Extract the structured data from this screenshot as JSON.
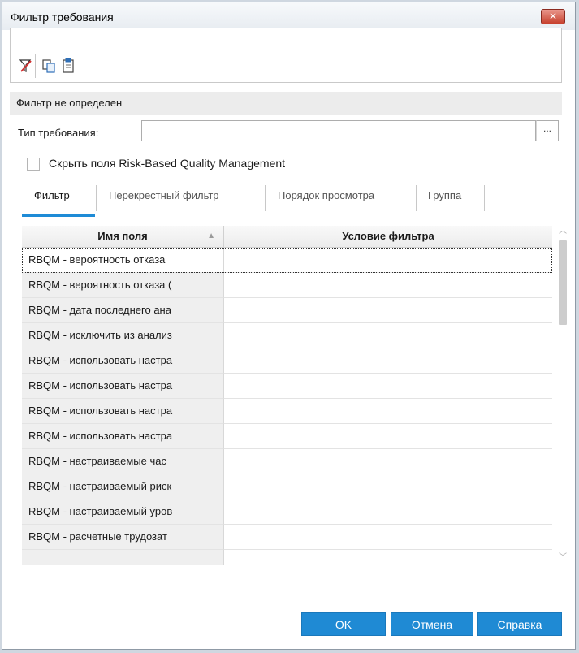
{
  "window": {
    "title": "Фильтр требования",
    "close_glyph": "✕"
  },
  "toolbar": {
    "icons": [
      "filter-clear-icon",
      "copy-icon",
      "paste-icon"
    ]
  },
  "filter_status": "Фильтр не определен",
  "requirement_type": {
    "label": "Тип требования:",
    "value": "",
    "browse_label": "..."
  },
  "hide_rbqm": {
    "label": "Скрыть поля Risk-Based Quality Management",
    "checked": false
  },
  "tabs": [
    {
      "label": "Фильтр",
      "active": true
    },
    {
      "label": "Перекрестный фильтр",
      "active": false
    },
    {
      "label": "Порядок просмотра",
      "active": false
    },
    {
      "label": "Группа",
      "active": false
    }
  ],
  "grid": {
    "columns": {
      "name": "Имя поля",
      "condition": "Условие фильтра"
    },
    "rows": [
      {
        "name": "RBQM - вероятность отказа",
        "condition": ""
      },
      {
        "name": "RBQM - вероятность отказа (",
        "condition": ""
      },
      {
        "name": "RBQM - дата последнего ана",
        "condition": ""
      },
      {
        "name": "RBQM - исключить из анализ",
        "condition": ""
      },
      {
        "name": "RBQM - использовать настра",
        "condition": ""
      },
      {
        "name": "RBQM - использовать настра",
        "condition": ""
      },
      {
        "name": "RBQM - использовать настра",
        "condition": ""
      },
      {
        "name": "RBQM - использовать настра",
        "condition": ""
      },
      {
        "name": "RBQM - настраиваемые час",
        "condition": ""
      },
      {
        "name": "RBQM - настраиваемый риск",
        "condition": ""
      },
      {
        "name": "RBQM - настраиваемый уров",
        "condition": ""
      },
      {
        "name": "RBQM - расчетные трудозат",
        "condition": ""
      },
      {
        "name": "",
        "condition": ""
      }
    ]
  },
  "buttons": {
    "ok": "OK",
    "cancel": "Отмена",
    "help": "Справка"
  },
  "colors": {
    "accent": "#1f8ad4",
    "close": "#c7412e"
  }
}
